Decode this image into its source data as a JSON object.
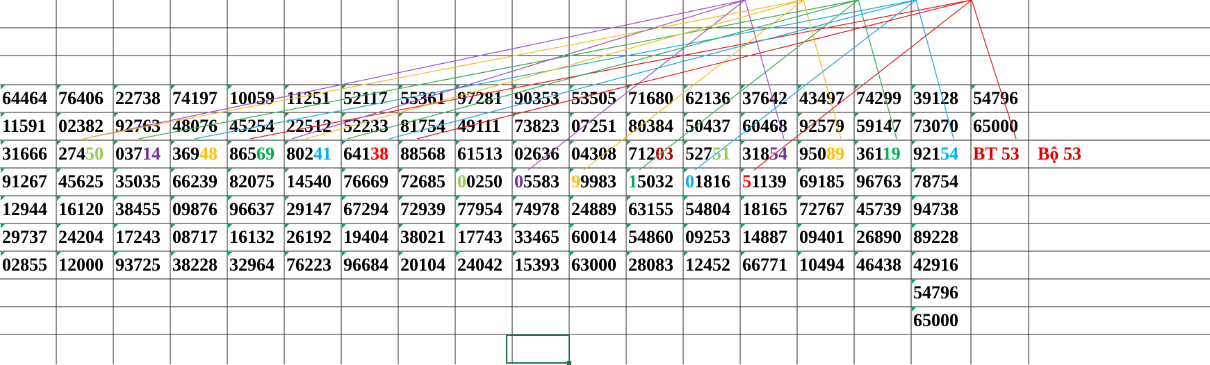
{
  "sheet": {
    "rows": [
      [
        "64464",
        "76406",
        "22738",
        "74197",
        "10059",
        "11251",
        "52117",
        "55361",
        "97281",
        "90353",
        "53505",
        "71680",
        "62136",
        "37642",
        "43497",
        "74299",
        "39128",
        "54796",
        "",
        ""
      ],
      [
        "11591",
        "02382",
        "92763",
        "48076",
        "45254",
        "22512",
        "52233",
        "81754",
        "49111",
        "73823",
        "07251",
        "80384",
        "50437",
        "60468",
        "92579",
        "59147",
        "73070",
        "65000",
        "",
        ""
      ],
      [
        "31666",
        "27450",
        "03714",
        "36948",
        "86569",
        "80241",
        "64138",
        "88568",
        "61513",
        "02636",
        "04308",
        "71203",
        "52751",
        "31854",
        "95089",
        "36119",
        "92154",
        "",
        "",
        ""
      ],
      [
        "91267",
        "45625",
        "35035",
        "66239",
        "82075",
        "14540",
        "76669",
        "72685",
        "00250",
        "05583",
        "99983",
        "15032",
        "01816",
        "51139",
        "69185",
        "96763",
        "78754",
        "",
        "",
        ""
      ],
      [
        "12944",
        "16120",
        "38455",
        "09876",
        "96637",
        "29147",
        "67294",
        "72939",
        "77954",
        "74978",
        "24889",
        "63155",
        "54804",
        "18165",
        "72767",
        "45739",
        "94738",
        "",
        "",
        ""
      ],
      [
        "29737",
        "24204",
        "17243",
        "08717",
        "16132",
        "26192",
        "19404",
        "38021",
        "17743",
        "33465",
        "60014",
        "54860",
        "09253",
        "14887",
        "09401",
        "26890",
        "89228",
        "",
        "",
        ""
      ],
      [
        "02855",
        "12000",
        "93725",
        "38228",
        "32964",
        "76223",
        "96684",
        "20104",
        "24042",
        "15393",
        "63000",
        "28083",
        "12452",
        "66771",
        "10494",
        "46438",
        "42916",
        "",
        "",
        ""
      ],
      [
        "",
        "",
        "",
        "",
        "",
        "",
        "",
        "",
        "",
        "",
        "",
        "",
        "",
        "",
        "",
        "",
        "54796",
        "",
        "",
        ""
      ],
      [
        "",
        "",
        "",
        "",
        "",
        "",
        "",
        "",
        "",
        "",
        "",
        "",
        "",
        "",
        "",
        "",
        "65000",
        "",
        "",
        ""
      ]
    ],
    "labels": {
      "bt": "BT 53",
      "bo": "Bộ 53"
    },
    "highlights": [
      {
        "row": 2,
        "col": 1,
        "start": 3,
        "len": 2,
        "color": "#92d050"
      },
      {
        "row": 2,
        "col": 2,
        "start": 3,
        "len": 2,
        "color": "#7030a0"
      },
      {
        "row": 2,
        "col": 3,
        "start": 3,
        "len": 2,
        "color": "#ffc000"
      },
      {
        "row": 2,
        "col": 4,
        "start": 3,
        "len": 2,
        "color": "#00b050"
      },
      {
        "row": 2,
        "col": 5,
        "start": 3,
        "len": 2,
        "color": "#00b0f0"
      },
      {
        "row": 2,
        "col": 6,
        "start": 3,
        "len": 2,
        "color": "#ff0000"
      },
      {
        "row": 2,
        "col": 11,
        "start": 3,
        "len": 2,
        "color": "#c00000"
      },
      {
        "row": 2,
        "col": 12,
        "start": 3,
        "len": 2,
        "color": "#92d050"
      },
      {
        "row": 2,
        "col": 13,
        "start": 3,
        "len": 2,
        "color": "#7030a0"
      },
      {
        "row": 2,
        "col": 14,
        "start": 3,
        "len": 2,
        "color": "#ffc000"
      },
      {
        "row": 2,
        "col": 15,
        "start": 3,
        "len": 2,
        "color": "#00b050"
      },
      {
        "row": 2,
        "col": 16,
        "start": 3,
        "len": 2,
        "color": "#00b0f0"
      },
      {
        "row": 3,
        "col": 8,
        "start": 0,
        "len": 1,
        "color": "#92d050"
      },
      {
        "row": 3,
        "col": 9,
        "start": 0,
        "len": 1,
        "color": "#7030a0"
      },
      {
        "row": 3,
        "col": 10,
        "start": 0,
        "len": 1,
        "color": "#ffc000"
      },
      {
        "row": 3,
        "col": 11,
        "start": 0,
        "len": 1,
        "color": "#00b050"
      },
      {
        "row": 3,
        "col": 12,
        "start": 0,
        "len": 1,
        "color": "#00b0f0"
      },
      {
        "row": 3,
        "col": 13,
        "start": 0,
        "len": 1,
        "color": "#ff0000"
      }
    ],
    "connector_colors": [
      "#a050c0",
      "#f0c020",
      "#30b050",
      "#20a8e0",
      "#e02020"
    ],
    "selected_cell": {
      "row": 10,
      "col": 8
    }
  }
}
